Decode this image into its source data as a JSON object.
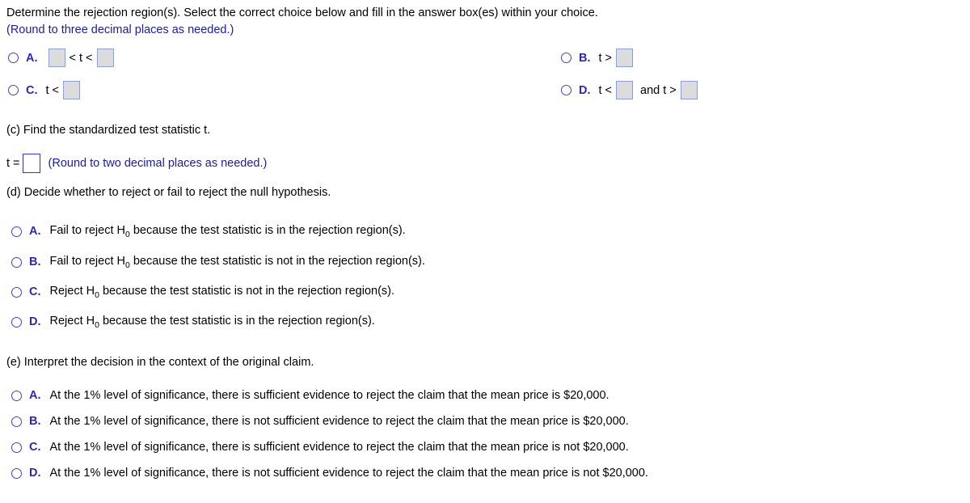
{
  "question": {
    "prompt": "Determine the rejection region(s). Select the correct choice below and fill in the answer box(es) within your choice.",
    "rounding_note": "(Round to three decimal places as needed.)"
  },
  "rejection_region_choices": [
    {
      "letter": "A.",
      "prefix": "",
      "mid": "< t <",
      "suffix": "",
      "boxes": 2,
      "layout": "box-mid-box"
    },
    {
      "letter": "B.",
      "prefix": "t >",
      "mid": "",
      "suffix": "",
      "boxes": 1,
      "layout": "prefix-box"
    },
    {
      "letter": "C.",
      "prefix": "t <",
      "mid": "",
      "suffix": "",
      "boxes": 1,
      "layout": "prefix-box"
    },
    {
      "letter": "D.",
      "prefix": "t <",
      "mid": "and t >",
      "suffix": "",
      "boxes": 2,
      "layout": "prefix-box-mid-box"
    }
  ],
  "part_c": {
    "heading": "(c) Find the standardized test statistic t.",
    "t_label": "t =",
    "t_value": "",
    "rounding_note": "(Round to two decimal places as needed.)"
  },
  "part_d": {
    "heading": "(d) Decide whether to reject or fail to reject the null hypothesis.",
    "choices": [
      {
        "letter": "A.",
        "pre": "Fail to reject H",
        "sub": "0",
        "post": " because the test statistic is in the rejection region(s)."
      },
      {
        "letter": "B.",
        "pre": "Fail to reject H",
        "sub": "0",
        "post": " because the test statistic is not in the rejection region(s)."
      },
      {
        "letter": "C.",
        "pre": "Reject H",
        "sub": "0",
        "post": " because the test statistic is not in the rejection region(s)."
      },
      {
        "letter": "D.",
        "pre": "Reject H",
        "sub": "0",
        "post": " because the test statistic is in the rejection region(s)."
      }
    ]
  },
  "part_e": {
    "heading": "(e) Interpret the decision in the context of the original claim.",
    "choices": [
      {
        "letter": "A.",
        "text": "At the 1% level of significance, there is sufficient evidence to reject the claim that the mean price is $20,000."
      },
      {
        "letter": "B.",
        "text": "At the 1% level of significance, there is not sufficient evidence to reject the claim that the mean price is $20,000."
      },
      {
        "letter": "C.",
        "text": "At the 1% level of significance, there is sufficient evidence to reject the claim that the mean price is not $20,000."
      },
      {
        "letter": "D.",
        "text": "At the 1% level of significance, there is not sufficient evidence to reject the claim that the mean price is not $20,000."
      }
    ]
  },
  "colors": {
    "accent_blue": "#2a2ab0",
    "note_blue": "#1a1aad",
    "box_fill": "#dcdcdc",
    "box_border": "#8d9fd4",
    "input_border": "#3232c8",
    "background": "#ffffff"
  }
}
